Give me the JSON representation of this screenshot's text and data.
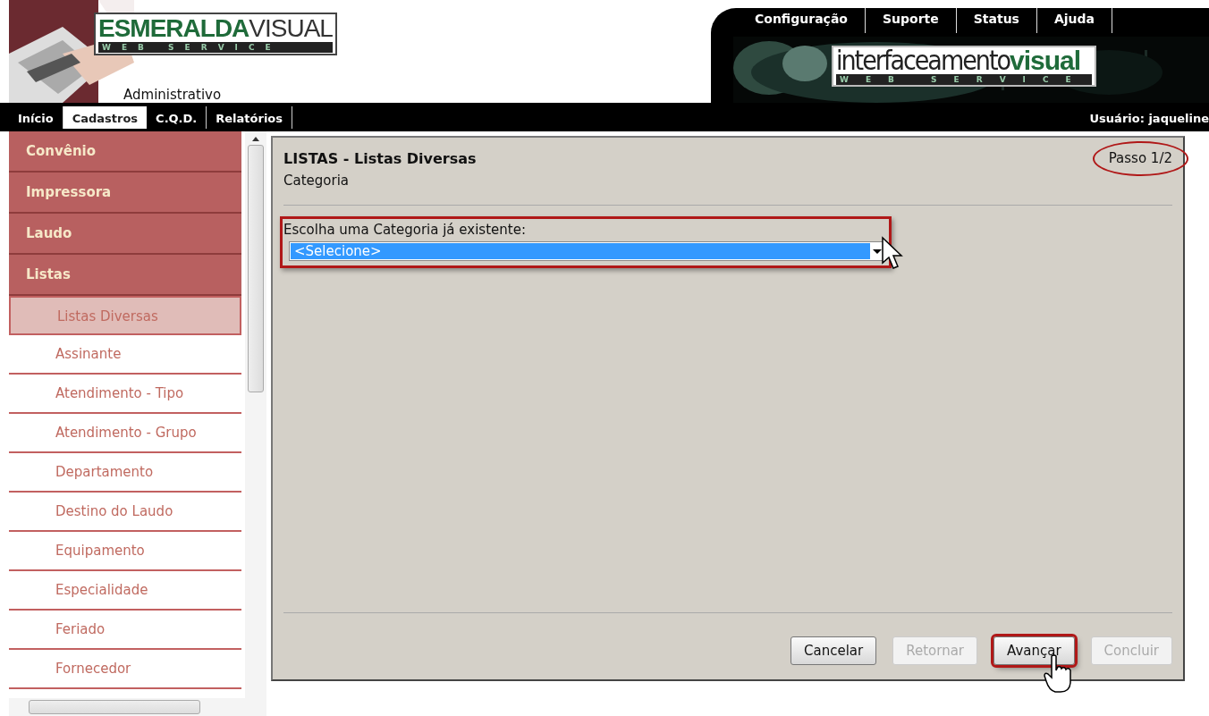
{
  "header": {
    "logo_left": {
      "brand_bold": "ESMERALDA",
      "brand_light": "VISUAL",
      "tagline": "WEB SERVICE"
    },
    "subtitle": "Administrativo",
    "top_links": [
      "Configuração",
      "Suporte",
      "Status",
      "Ajuda"
    ],
    "logo_right": {
      "brand_light": "interfaceamento",
      "brand_bold": "visual",
      "tagline": "WEB SERVICE"
    }
  },
  "nav": {
    "tabs": [
      {
        "label": "Início",
        "selected": false
      },
      {
        "label": "Cadastros",
        "selected": true
      },
      {
        "label": "C.Q.D.",
        "selected": false
      },
      {
        "label": "Relatórios",
        "selected": false
      }
    ],
    "user": "Usuário: jaqueline"
  },
  "sidebar": {
    "items": [
      {
        "kind": "group",
        "label": "Convênio",
        "selected": false
      },
      {
        "kind": "group",
        "label": "Impressora",
        "selected": false
      },
      {
        "kind": "group",
        "label": "Laudo",
        "selected": false
      },
      {
        "kind": "group",
        "label": "Listas",
        "selected": false
      },
      {
        "kind": "sub",
        "label": "Listas Diversas",
        "selected": true
      },
      {
        "kind": "sub",
        "label": "Assinante",
        "selected": false
      },
      {
        "kind": "sub",
        "label": "Atendimento - Tipo",
        "selected": false
      },
      {
        "kind": "sub",
        "label": "Atendimento - Grupo",
        "selected": false
      },
      {
        "kind": "sub",
        "label": "Departamento",
        "selected": false
      },
      {
        "kind": "sub",
        "label": "Destino do Laudo",
        "selected": false
      },
      {
        "kind": "sub",
        "label": "Equipamento",
        "selected": false
      },
      {
        "kind": "sub",
        "label": "Especialidade",
        "selected": false
      },
      {
        "kind": "sub",
        "label": "Feriado",
        "selected": false
      },
      {
        "kind": "sub",
        "label": "Fornecedor",
        "selected": false
      }
    ]
  },
  "panel": {
    "title": "LISTAS - Listas Diversas",
    "subtitle": "Categoria",
    "step": "Passo 1/2",
    "field_label": "Escolha uma Categoria já existente:",
    "select_value": "<Selecione>",
    "buttons": [
      {
        "label": "Cancelar",
        "disabled": false,
        "highlighted": false
      },
      {
        "label": "Retornar",
        "disabled": true,
        "highlighted": false
      },
      {
        "label": "Avançar",
        "disabled": false,
        "highlighted": true
      },
      {
        "label": "Concluir",
        "disabled": true,
        "highlighted": false
      }
    ]
  }
}
